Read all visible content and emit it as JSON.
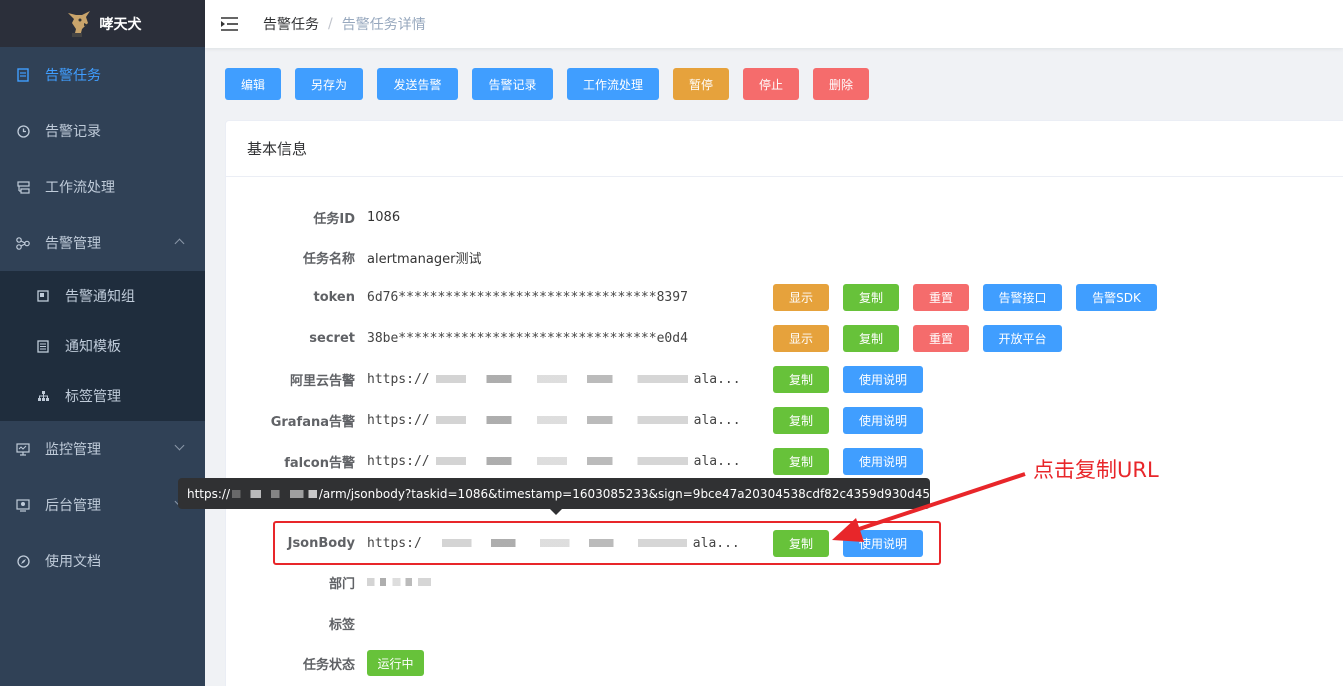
{
  "app": {
    "name": "哮天犬"
  },
  "sidebar": {
    "items": [
      {
        "label": "告警任务",
        "icon": "document-icon",
        "active": true
      },
      {
        "label": "告警记录",
        "icon": "clock-icon"
      },
      {
        "label": "工作流处理",
        "icon": "workflow-icon"
      },
      {
        "label": "告警管理",
        "icon": "cluster-icon",
        "expanded": true,
        "children": [
          {
            "label": "告警通知组",
            "icon": "group-icon"
          },
          {
            "label": "通知模板",
            "icon": "template-icon"
          },
          {
            "label": "标签管理",
            "icon": "tree-icon"
          }
        ]
      },
      {
        "label": "监控管理",
        "icon": "monitor-icon"
      },
      {
        "label": "后台管理",
        "icon": "admin-icon"
      },
      {
        "label": "使用文档",
        "icon": "compass-icon"
      }
    ]
  },
  "breadcrumb": {
    "parent": "告警任务",
    "separator": "/",
    "current": "告警任务详情"
  },
  "toolbar": {
    "edit": "编辑",
    "save_as": "另存为",
    "send_alert": "发送告警",
    "alert_records": "告警记录",
    "workflow": "工作流处理",
    "pause": "暂停",
    "stop": "停止",
    "delete": "删除"
  },
  "card": {
    "title": "基本信息"
  },
  "fields": {
    "task_id": {
      "label": "任务ID",
      "value": "1086"
    },
    "task_name": {
      "label": "任务名称",
      "value": "alertmanager测试"
    },
    "token": {
      "label": "token",
      "value": "6d76*********************************8397",
      "btn_show": "显示",
      "btn_copy": "复制",
      "btn_reset": "重置",
      "btn_api": "告警接口",
      "btn_sdk": "告警SDK"
    },
    "secret": {
      "label": "secret",
      "value": "38be*********************************e0d4",
      "btn_show": "显示",
      "btn_copy": "复制",
      "btn_reset": "重置",
      "btn_open": "开放平台"
    },
    "aliyun": {
      "label": "阿里云告警",
      "prefix": "https://",
      "suffix": "ala...",
      "btn_copy": "复制",
      "btn_help": "使用说明"
    },
    "grafana": {
      "label": "Grafana告警",
      "prefix": "https://",
      "suffix": "ala...",
      "btn_copy": "复制",
      "btn_help": "使用说明"
    },
    "falcon": {
      "label": "falcon告警",
      "prefix": "https://",
      "suffix": "ala...",
      "btn_copy": "复制",
      "btn_help": "使用说明"
    },
    "jsonbody": {
      "label": "JsonBody",
      "prefix": "https:/",
      "suffix": "ala...",
      "btn_copy": "复制",
      "btn_help": "使用说明"
    },
    "department": {
      "label": "部门"
    },
    "tags": {
      "label": "标签"
    },
    "status": {
      "label": "任务状态",
      "value": "运行中"
    }
  },
  "tooltip": {
    "prefix": "https://",
    "suffix": "/arm/jsonbody?taskid=1086&timestamp=1603085233&sign=9bce47a20304538cdf82c4359d930d45"
  },
  "annotation": {
    "text": "点击复制URL",
    "color": "#e8262a"
  },
  "colors": {
    "primary": "#409eff",
    "warning": "#e6a23c",
    "danger": "#f56c6c",
    "success": "#67c23a",
    "sidebar": "#304156"
  }
}
